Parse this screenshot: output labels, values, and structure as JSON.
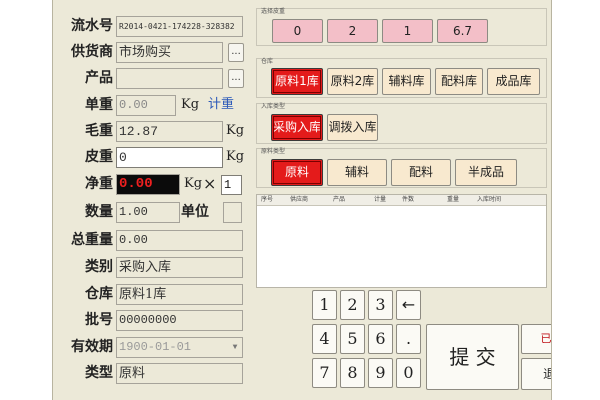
{
  "form": {
    "serial": {
      "label": "流水号",
      "value": "R2014-0421-174228-328382"
    },
    "supplier": {
      "label": "供货商",
      "value": "市场购买",
      "btn": "..."
    },
    "product": {
      "label": "产品",
      "value": "",
      "btn": "..."
    },
    "unit_weight": {
      "label": "单重",
      "value": "0.00",
      "unit": "Kg",
      "link": "计重"
    },
    "gross": {
      "label": "毛重",
      "value": "12.87",
      "unit": "Kg"
    },
    "tare": {
      "label": "皮重",
      "value": "0",
      "unit": "Kg"
    },
    "net": {
      "label": "净重",
      "value": "0.00",
      "unit": "Kg",
      "times": "×",
      "multiplier": "1"
    },
    "qty": {
      "label": "数量",
      "value": "1.00",
      "unit_label": "单位",
      "unit_value": ""
    },
    "total": {
      "label": "总重量",
      "value": "0.00"
    },
    "category": {
      "label": "类别",
      "value": "采购入库"
    },
    "warehouse": {
      "label": "仓库",
      "value": "原料1库"
    },
    "batch": {
      "label": "批号",
      "value": "00000000"
    },
    "expiry": {
      "label": "有效期",
      "value": "1900-01-01",
      "arrow": "▼"
    },
    "type": {
      "label": "类型",
      "value": "原料"
    }
  },
  "right": {
    "scale": {
      "title": "选择皮重",
      "options": [
        "0",
        "2",
        "1",
        "6.7"
      ]
    },
    "warehouse": {
      "title": "仓库",
      "options": [
        "原料1库",
        "原料2库",
        "辅料库",
        "配料库",
        "成品库"
      ]
    },
    "intype": {
      "title": "入库类型",
      "options": [
        "采购入库",
        "调拨入库"
      ]
    },
    "mattype": {
      "title": "原料类型",
      "options": [
        "原料",
        "辅料",
        "配料",
        "半成品"
      ]
    },
    "table": {
      "columns": [
        "序号",
        "供应商",
        "产品",
        "计量",
        "件数",
        "重量",
        "入库时间"
      ]
    },
    "keypad": {
      "keys": [
        "1",
        "2",
        "3",
        "←",
        "4",
        "5",
        "6",
        ".",
        "7",
        "8",
        "9",
        "0"
      ],
      "submit": "提 交",
      "closed": "已关闭",
      "exit": "退 出"
    }
  },
  "colors": {
    "selected": "#e41b1b",
    "pink": "#f3bfc8",
    "cream": "#f8e9cf",
    "background": "#ece9d8"
  }
}
